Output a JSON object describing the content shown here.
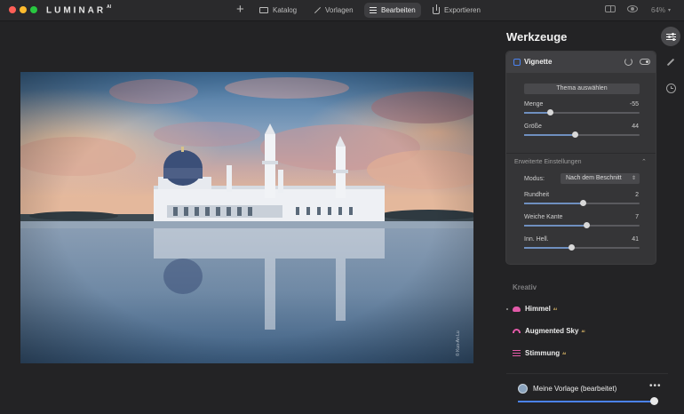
{
  "app": {
    "logo": "LUMINAR",
    "logo_sup": "AI"
  },
  "topbar": {
    "add_label": "+",
    "nav": [
      {
        "label": "Katalog",
        "icon": "folder-icon"
      },
      {
        "label": "Vorlagen",
        "icon": "magic-wand-icon"
      },
      {
        "label": "Bearbeiten",
        "icon": "edit-lines-icon",
        "active": true
      },
      {
        "label": "Exportieren",
        "icon": "share-icon"
      }
    ],
    "zoom": "64%"
  },
  "photo": {
    "watermark": "© Kuo-An Lu"
  },
  "tools": {
    "title": "Werkzeuge",
    "vignette": {
      "title": "Vignette",
      "theme_button": "Thema auswählen",
      "menge": {
        "label": "Menge",
        "value": "-55",
        "fraction": 0.225
      },
      "groesse": {
        "label": "Größe",
        "value": "44",
        "fraction": 0.44
      },
      "advanced_title": "Erweiterte Einstellungen",
      "modus": {
        "label": "Modus:",
        "value": "Nach dem Beschnitt"
      },
      "rundheit": {
        "label": "Rundheit",
        "value": "2",
        "fraction": 0.51
      },
      "weiche_kante": {
        "label": "Weiche Kante",
        "value": "7",
        "fraction": 0.535
      },
      "inn_hell": {
        "label": "Inn. Hell.",
        "value": "41",
        "fraction": 0.41
      }
    }
  },
  "kreativ": {
    "title": "Kreativ",
    "items": [
      {
        "label": "Himmel",
        "badge": "AI"
      },
      {
        "label": "Augmented Sky",
        "badge": "AI"
      },
      {
        "label": "Stimmung",
        "badge": "AI"
      }
    ]
  },
  "preset": {
    "name": "Meine Vorlage (bearbeitet)",
    "more": "•••",
    "amount_fraction": 1.0
  },
  "colors": {
    "accent": "#4b83f0",
    "ai_pink": "#e25aa8",
    "ai_badge": "#e8c06a"
  }
}
